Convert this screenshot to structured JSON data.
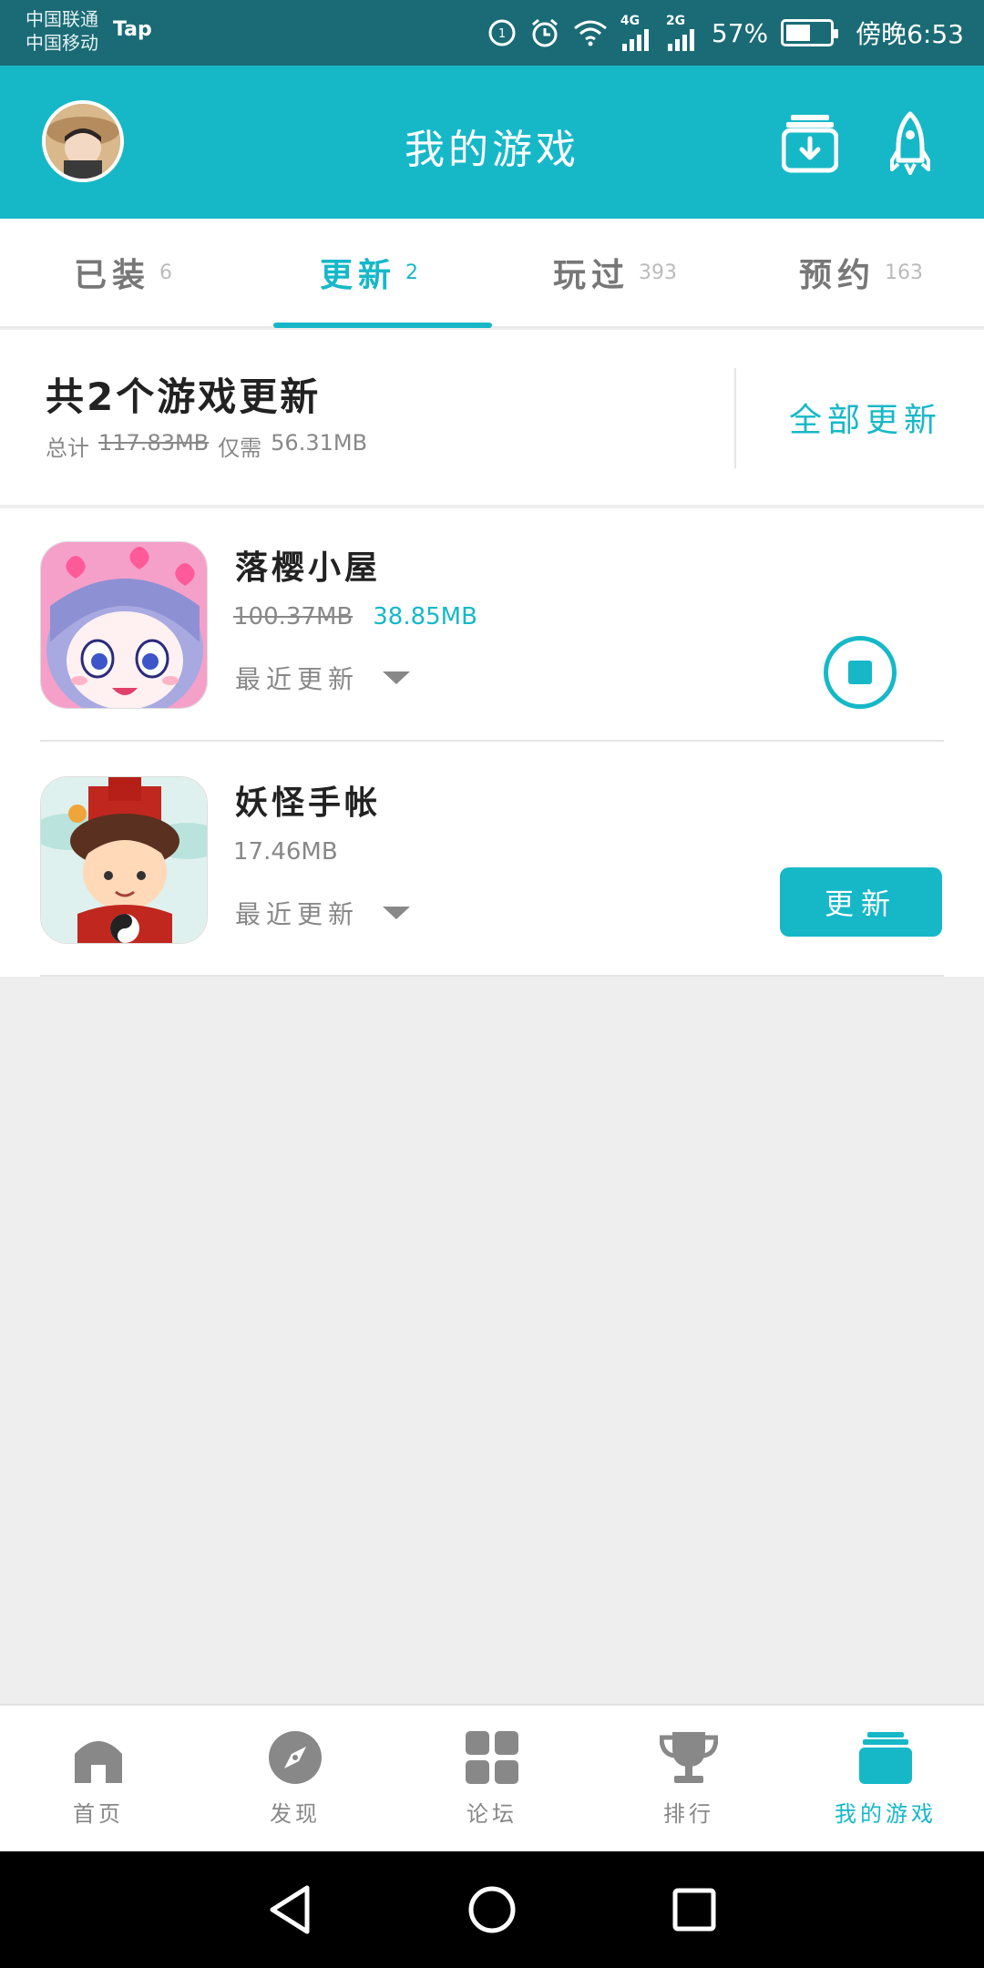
{
  "status_bar": {
    "carrier_1": "中国联通",
    "carrier_2": "中国移动",
    "app_badge": "Tap",
    "network_4g": "4G",
    "network_2g": "2G",
    "battery": "57%",
    "battery_level": 0.57,
    "time": "傍晚6:53"
  },
  "header": {
    "title": "我的游戏",
    "download_icon": "download-box-icon",
    "rocket_icon": "rocket-icon"
  },
  "tabs": [
    {
      "label": "已装",
      "count": "6"
    },
    {
      "label": "更新",
      "count": "2"
    },
    {
      "label": "玩过",
      "count": "393"
    },
    {
      "label": "预约",
      "count": "163"
    }
  ],
  "active_tab": 1,
  "summary": {
    "title": "共2个游戏更新",
    "total_label": "总计",
    "total_size": "117.83MB",
    "need_label": "仅需",
    "need_size": "56.31MB",
    "update_all": "全部更新"
  },
  "games": [
    {
      "name": "落樱小屋",
      "old_size": "100.37MB",
      "new_size": "38.85MB",
      "recent": "最近更新",
      "action": "downloading"
    },
    {
      "name": "妖怪手帐",
      "size": "17.46MB",
      "recent": "最近更新",
      "action_label": "更新"
    }
  ],
  "colors": {
    "accent": "#16b8c8",
    "status_bar": "#1a6b75"
  },
  "bottom_nav": [
    {
      "label": "首页",
      "icon": "home-icon"
    },
    {
      "label": "发现",
      "icon": "compass-icon"
    },
    {
      "label": "论坛",
      "icon": "grid-icon"
    },
    {
      "label": "排行",
      "icon": "trophy-icon"
    },
    {
      "label": "我的游戏",
      "icon": "stack-icon"
    }
  ],
  "active_nav": 4
}
